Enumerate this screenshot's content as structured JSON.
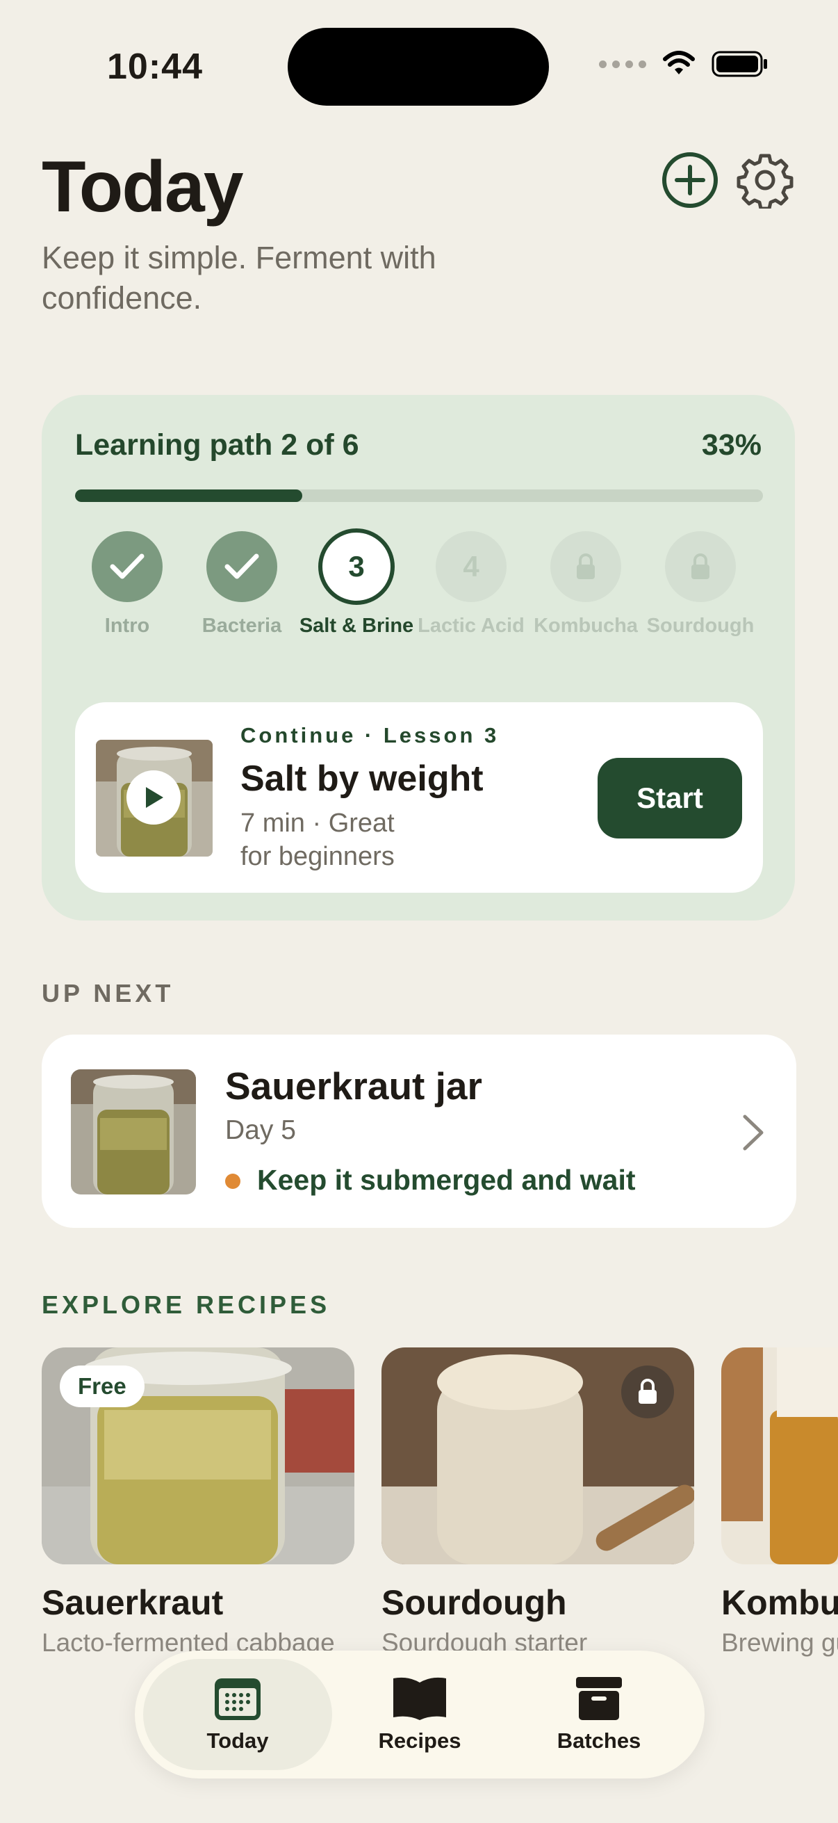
{
  "status": {
    "time": "10:44"
  },
  "header": {
    "title": "Today",
    "subtitle": "Keep it simple. Ferment with confidence."
  },
  "learning_path": {
    "label": "Learning path 2 of 6",
    "percent_text": "33%",
    "progress": 0.33,
    "steps": [
      {
        "label": "Intro",
        "state": "done"
      },
      {
        "label": "Bacteria",
        "state": "done"
      },
      {
        "label": "Salt & Brine",
        "state": "current",
        "number": "3"
      },
      {
        "label": "Lactic Acid",
        "state": "future",
        "number": "4"
      },
      {
        "label": "Kombucha",
        "state": "locked"
      },
      {
        "label": "Sourdough",
        "state": "locked"
      }
    ],
    "lesson": {
      "eyebrow": "Continue · Lesson 3",
      "title": "Salt by weight",
      "meta": "7 min · Great for beginners",
      "start_label": "Start"
    }
  },
  "up_next": {
    "section_label": "UP NEXT",
    "title": "Sauerkraut jar",
    "day": "Day 5",
    "status": "Keep it submerged and wait",
    "status_color": "#e08a35"
  },
  "explore": {
    "section_label": "EXPLORE RECIPES",
    "recipes": [
      {
        "name": "Sauerkraut",
        "desc": "Lacto-fermented cabbage",
        "badge": "Free"
      },
      {
        "name": "Sourdough",
        "desc": "Sourdough starter",
        "badge": "lock-icon"
      },
      {
        "name": "Kombucha",
        "desc": "Brewing guide",
        "badge": ""
      }
    ]
  },
  "tabbar": {
    "tabs": [
      {
        "label": "Today",
        "icon": "calendar-icon",
        "active": true
      },
      {
        "label": "Recipes",
        "icon": "book-icon",
        "active": false
      },
      {
        "label": "Batches",
        "icon": "archive-box-icon",
        "active": false
      }
    ]
  },
  "colors": {
    "accent": "#244b2f",
    "background": "#f2efe7",
    "path_card": "#dfeadc"
  }
}
